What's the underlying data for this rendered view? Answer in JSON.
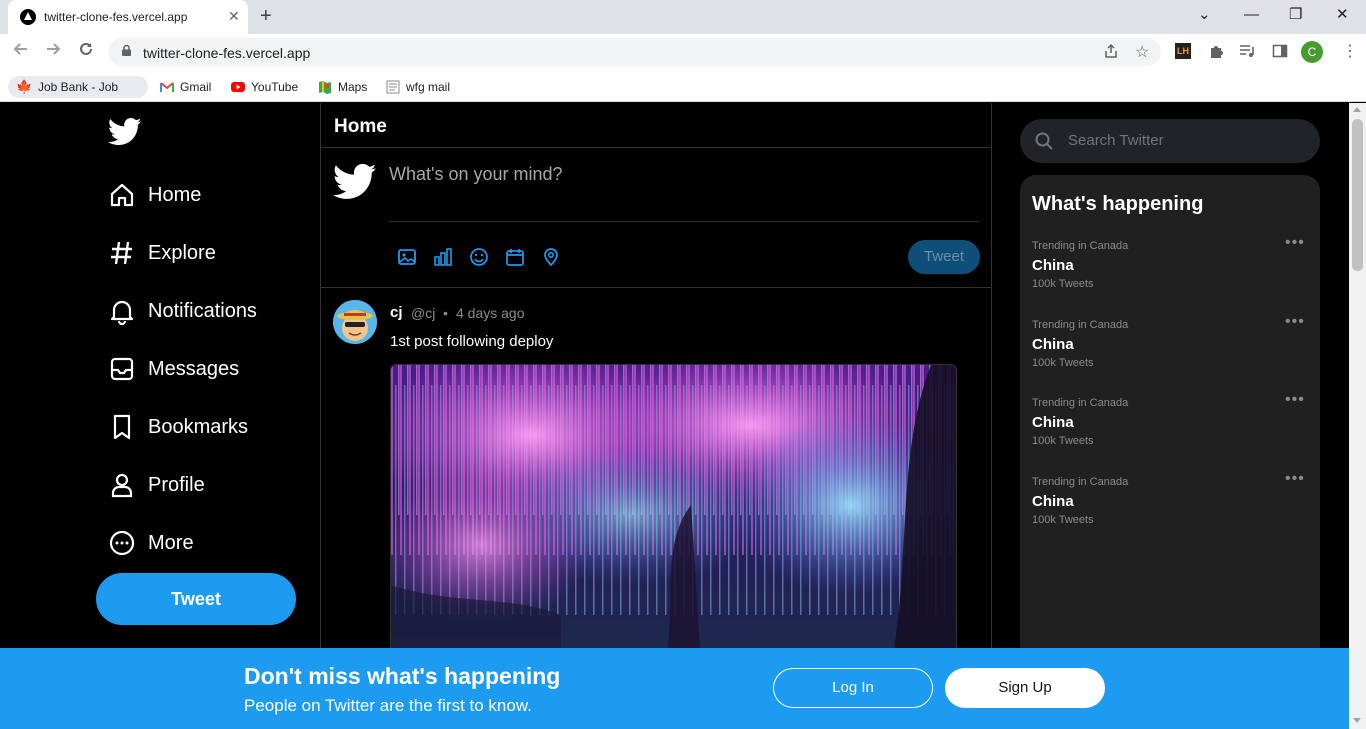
{
  "browser": {
    "tab_title": "twitter-clone-fes.vercel.app",
    "close_tab": "✕",
    "new_tab": "+",
    "window_controls": {
      "minimize": "—",
      "restore": "❐",
      "close": "✕",
      "tab_search": "⌄"
    },
    "url": "twitter-clone-fes.vercel.app",
    "extension_lh": "LH",
    "profile_initial": "C",
    "bookmarks": [
      {
        "label": "Job Bank - Job Bank",
        "icon": "maple-leaf-icon"
      },
      {
        "label": "Gmail",
        "icon": "gmail-icon"
      },
      {
        "label": "YouTube",
        "icon": "youtube-icon"
      },
      {
        "label": "Maps",
        "icon": "maps-icon"
      },
      {
        "label": "wfg mail",
        "icon": "page-icon"
      }
    ]
  },
  "sidebar": {
    "items": [
      {
        "label": "Home",
        "icon": "home-icon"
      },
      {
        "label": "Explore",
        "icon": "hashtag-icon"
      },
      {
        "label": "Notifications",
        "icon": "bell-icon"
      },
      {
        "label": "Messages",
        "icon": "inbox-icon"
      },
      {
        "label": "Bookmarks",
        "icon": "bookmark-icon"
      },
      {
        "label": "Profile",
        "icon": "user-icon"
      },
      {
        "label": "More",
        "icon": "more-circle-icon"
      }
    ],
    "tweet_button": "Tweet"
  },
  "main": {
    "title": "Home",
    "composer": {
      "placeholder": "What's on your mind?",
      "tweet_button": "Tweet",
      "icons": [
        "image-icon",
        "poll-icon",
        "emoji-icon",
        "schedule-icon",
        "location-icon"
      ]
    },
    "post": {
      "name": "cj",
      "handle": "@cj",
      "separator": "•",
      "time": "4 days ago",
      "text": "1st post following deploy"
    }
  },
  "right": {
    "search_placeholder": "Search Twitter",
    "trends_title": "What's happening",
    "trends": [
      {
        "context": "Trending in Canada",
        "name": "China",
        "count": "100k Tweets"
      },
      {
        "context": "Trending in Canada",
        "name": "China",
        "count": "100k Tweets"
      },
      {
        "context": "Trending in Canada",
        "name": "China",
        "count": "100k Tweets"
      },
      {
        "context": "Trending in Canada",
        "name": "China",
        "count": "100k Tweets"
      }
    ],
    "more_glyph": "•••"
  },
  "banner": {
    "title": "Don't miss what's happening",
    "subtitle": "People on Twitter are the first to know.",
    "login": "Log In",
    "signup": "Sign Up"
  },
  "colors": {
    "accent": "#1d9bf0",
    "background": "#000000",
    "panel": "#202020"
  }
}
